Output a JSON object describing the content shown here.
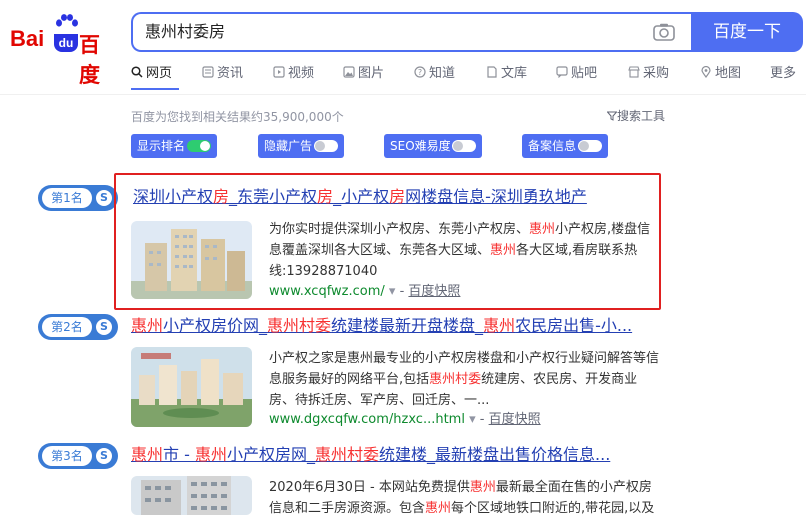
{
  "logo": {
    "bai": "Bai",
    "du": "du",
    "cn": "百度"
  },
  "search": {
    "query": "惠州村委房",
    "button": "百度一下"
  },
  "tabs": [
    {
      "label": "网页",
      "icon": "search-icon"
    },
    {
      "label": "资讯",
      "icon": "news-icon"
    },
    {
      "label": "视频",
      "icon": "video-icon"
    },
    {
      "label": "图片",
      "icon": "image-icon"
    },
    {
      "label": "知道",
      "icon": "question-icon"
    },
    {
      "label": "文库",
      "icon": "document-icon"
    },
    {
      "label": "贴吧",
      "icon": "forum-icon"
    },
    {
      "label": "采购",
      "icon": "shop-icon"
    },
    {
      "label": "地图",
      "icon": "map-icon"
    },
    {
      "label": "更多",
      "icon": ""
    }
  ],
  "result_count": "百度为您找到相关结果约35,900,000个",
  "tools": "搜索工具",
  "toggles": [
    {
      "label": "显示排名",
      "state": "on"
    },
    {
      "label": "隐藏广告",
      "state": "off"
    },
    {
      "label": "SEO难易度",
      "state": "off"
    },
    {
      "label": "备案信息",
      "state": "off"
    }
  ],
  "colors": {
    "brand_blue": "#4e6ef2",
    "highlight_red": "#f73131",
    "link_blue": "#2440b3",
    "url_green": "#0e8a2e",
    "outline_red": "#e02020"
  },
  "results": [
    {
      "rank": "第1名",
      "title_parts": [
        "深圳小产权",
        "房",
        "_东莞小产权",
        "房",
        "_小产权",
        "房",
        "网楼盘信息-深圳勇玖地产"
      ],
      "desc_parts": [
        "为你实时提供深圳小产权房、东莞小产权房、",
        "惠州",
        "小产权房,楼盘信息覆盖深圳各大区域、东莞各大区域、",
        "惠州",
        "各大区域,看房联系热线:13928871040"
      ],
      "url": "www.xcqfwz.com/",
      "snapshot": "百度快照"
    },
    {
      "rank": "第2名",
      "title_parts": [
        "惠州",
        "小产权房价网_",
        "惠州村委",
        "统建楼最新开盘楼盘_",
        "惠州",
        "农民房出售-小..."
      ],
      "desc_parts": [
        "小产权之家是惠州最专业的小产权房楼盘和小产权行业疑问解答等信息服务最好的网络平台,包括",
        "惠州村委",
        "统建房、农民房、开发商业房、待拆迁房、军产房、回迁房、一..."
      ],
      "url": "www.dgxcqfw.com/hzxc...html",
      "snapshot": "百度快照"
    },
    {
      "rank": "第3名",
      "title_parts": [
        "惠州",
        "市 - ",
        "惠州",
        "小产权房网_",
        "惠州村委",
        "统建楼_最新楼盘出售价格信息..."
      ],
      "desc_parts": [
        "2020年6月30日 - 本网站免费提供",
        "惠州",
        "最新最全面在售的小产权房信息和二手房源资源。包含",
        "惠州",
        "每个区域地铁口附近的,带花园,以及独栋"
      ],
      "url": "",
      "snapshot": ""
    }
  ]
}
